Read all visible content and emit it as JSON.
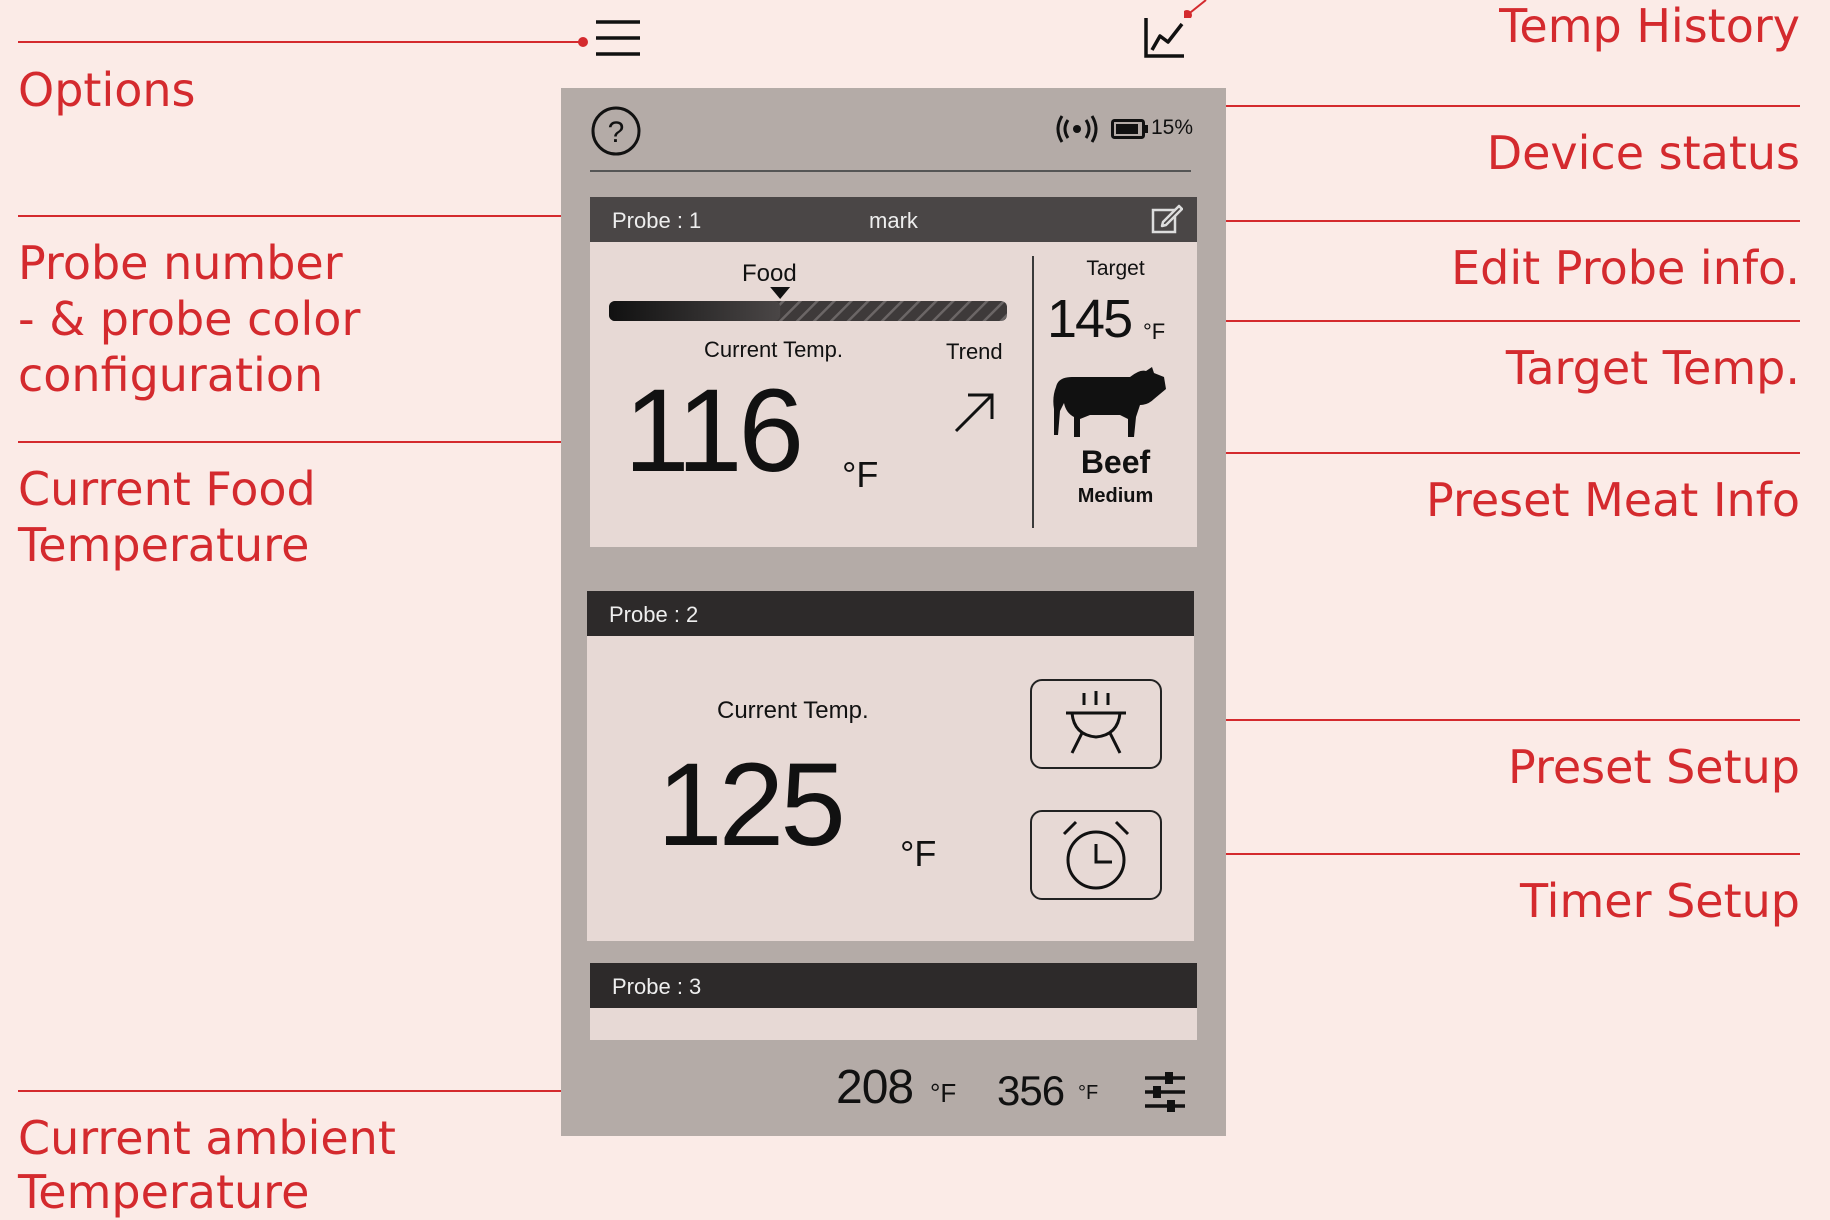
{
  "annotations": {
    "options": "Options",
    "probe_number_lines": [
      "Probe number",
      "- & probe color",
      "configuration"
    ],
    "current_food_lines": [
      "Current Food",
      "Temperature"
    ],
    "ambient_lines": [
      "Current ambient",
      "Temperature"
    ],
    "temp_history": "Temp History",
    "device_status": "Device status",
    "edit_probe": "Edit Probe info.",
    "target_temp": "Target Temp.",
    "preset_meat": "Preset Meat Info",
    "preset_setup": "Preset Setup",
    "timer_setup": "Timer Setup"
  },
  "status": {
    "battery": "15%"
  },
  "probe1": {
    "label": "Probe : 1",
    "name": "mark",
    "food_label": "Food",
    "current_label": "Current Temp.",
    "trend_label": "Trend",
    "current_temp": "116",
    "unit": "°F",
    "target_label": "Target",
    "target_temp": "145",
    "meat": "Beef",
    "doneness": "Medium",
    "progress": 0.43
  },
  "probe2": {
    "label": "Probe : 2",
    "current_label": "Current Temp.",
    "current_temp": "125",
    "unit": "°F"
  },
  "probe3": {
    "label": "Probe : 3"
  },
  "ambient": {
    "temp1": "208",
    "temp2": "356",
    "unit": "°F"
  },
  "colors": {
    "accent": "#d42a2e",
    "background": "#fbebe7",
    "phone": "#b4aba7",
    "card": "#e7d9d5",
    "header": "#2d2a2a"
  },
  "icons": [
    "menu-icon",
    "chart-icon",
    "help-icon",
    "signal-icon",
    "battery-icon",
    "edit-icon",
    "trend-arrow-icon",
    "cow-icon",
    "grill-icon",
    "alarm-clock-icon",
    "sliders-icon"
  ]
}
